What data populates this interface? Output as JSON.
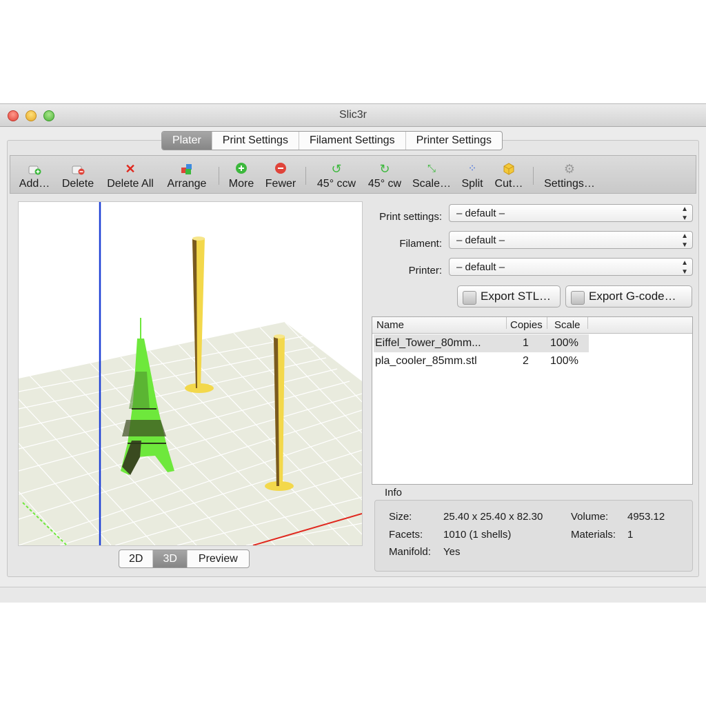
{
  "window": {
    "title": "Slic3r"
  },
  "tabs": [
    "Plater",
    "Print Settings",
    "Filament Settings",
    "Printer Settings"
  ],
  "toolbar": {
    "add": "Add…",
    "delete": "Delete",
    "delete_all": "Delete All",
    "arrange": "Arrange",
    "more": "More",
    "fewer": "Fewer",
    "rotate_ccw": "45° ccw",
    "rotate_cw": "45° cw",
    "scale": "Scale…",
    "split": "Split",
    "cut": "Cut…",
    "settings": "Settings…"
  },
  "view_tabs": [
    "2D",
    "3D",
    "Preview"
  ],
  "presets": {
    "print_label": "Print settings:",
    "print_value": "– default –",
    "filament_label": "Filament:",
    "filament_value": "– default –",
    "printer_label": "Printer:",
    "printer_value": "– default –"
  },
  "export": {
    "stl": "Export STL…",
    "gcode": "Export G-code…"
  },
  "objects": {
    "headers": {
      "name": "Name",
      "copies": "Copies",
      "scale": "Scale"
    },
    "rows": [
      {
        "name": "Eiffel_Tower_80mm...",
        "copies": "1",
        "scale": "100%"
      },
      {
        "name": "pla_cooler_85mm.stl",
        "copies": "2",
        "scale": "100%"
      }
    ]
  },
  "info": {
    "title": "Info",
    "size_label": "Size:",
    "size": "25.40 x 25.40 x 82.30",
    "volume_label": "Volume:",
    "volume": "4953.12",
    "facets_label": "Facets:",
    "facets": "1010 (1 shells)",
    "materials_label": "Materials:",
    "materials": "1",
    "manifold_label": "Manifold:",
    "manifold": "Yes"
  },
  "colors": {
    "eiffel_model": "#6ee83c",
    "cooler_model": "#f3d84b",
    "x_axis": "#e0281e",
    "y_axis": "#1c3fd6",
    "bed": "#e9ebde"
  }
}
